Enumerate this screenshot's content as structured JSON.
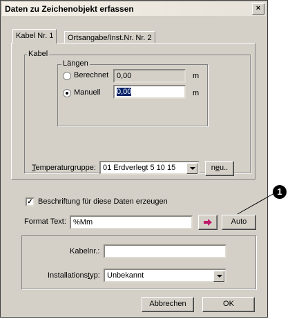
{
  "dialog": {
    "title": "Daten zu Zeichenobjekt erfassen",
    "close_glyph": "×"
  },
  "tabs": [
    {
      "label": "Kabel Nr. 1"
    },
    {
      "label": "Ortsangabe/Inst.Nr. Nr. 2"
    }
  ],
  "kabel_group": {
    "label": "Kabel"
  },
  "laengen_group": {
    "label": "Längen"
  },
  "berechnet": {
    "label": "Berechnet",
    "value": "0,00",
    "unit": "m"
  },
  "manuell": {
    "label": "Manuell",
    "value": "0,00",
    "unit": "m"
  },
  "temperatur": {
    "label_pre": "T",
    "label_post": "emperaturgruppe:",
    "selected": "01 Erdverlegt 5 10 15",
    "neu_pre": "n",
    "neu_u": "e",
    "neu_post": "u.."
  },
  "beschriftung": {
    "checked": true,
    "label": "Beschriftung für diese Daten erzeugen"
  },
  "format_text": {
    "label": "Format Text:",
    "value": "%Mm",
    "auto_label": "Auto"
  },
  "callout": {
    "number": "1"
  },
  "kabelnr": {
    "label": "Kabelnr.:",
    "value": ""
  },
  "installationstyp": {
    "label_pre": "Installations",
    "label_u": "t",
    "label_post": "yp:",
    "selected": "Unbekannt"
  },
  "buttons": {
    "cancel": "Abbrechen",
    "ok": "OK"
  },
  "colors": {
    "dialog_bg": "#d4d0c8",
    "selection": "#0a246a",
    "arrow": "#c0186c"
  }
}
